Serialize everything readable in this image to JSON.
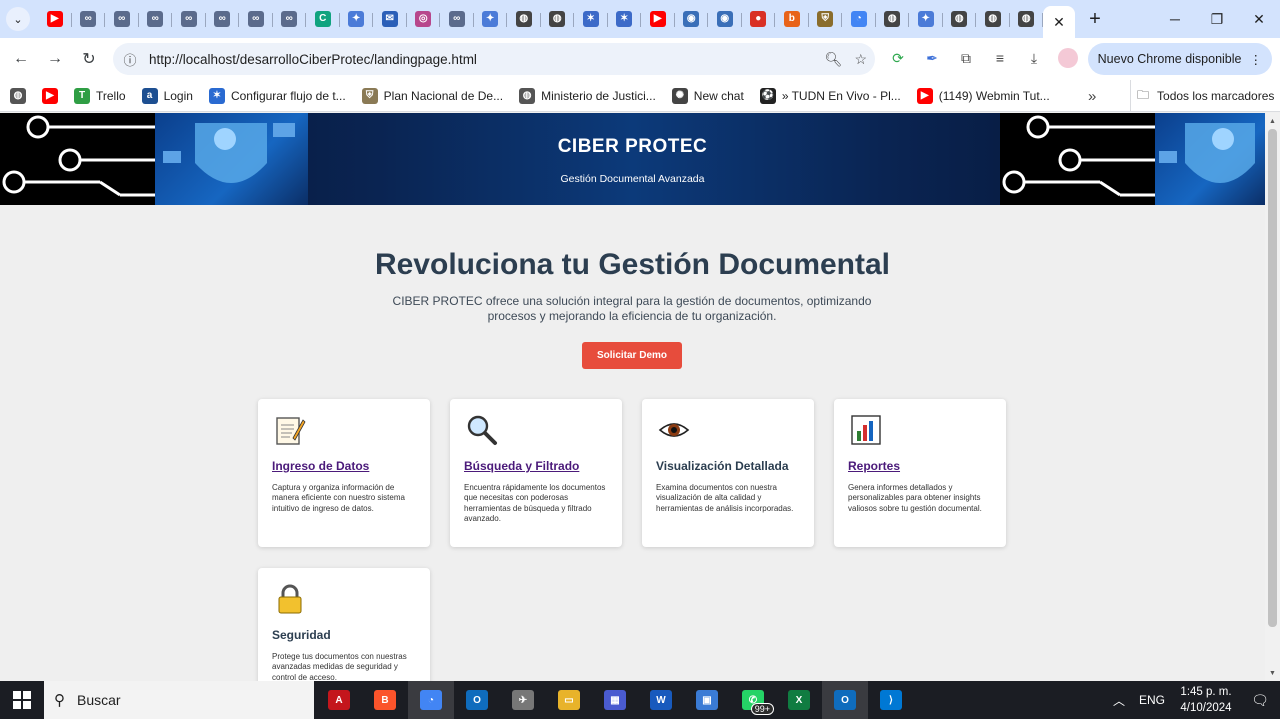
{
  "browser": {
    "tabs": [
      {
        "icon": "youtube-icon",
        "color": "#ff0000",
        "glyph": "▶"
      },
      {
        "icon": "app-icon",
        "color": "#5b6b8c",
        "glyph": "∞"
      },
      {
        "icon": "app-icon",
        "color": "#5b6b8c",
        "glyph": "∞"
      },
      {
        "icon": "app-icon",
        "color": "#5b6b8c",
        "glyph": "∞"
      },
      {
        "icon": "app-icon",
        "color": "#5b6b8c",
        "glyph": "∞"
      },
      {
        "icon": "app-icon",
        "color": "#5b6b8c",
        "glyph": "∞"
      },
      {
        "icon": "app-icon",
        "color": "#5b6b8c",
        "glyph": "∞"
      },
      {
        "icon": "app-icon",
        "color": "#5b6b8c",
        "glyph": "∞"
      },
      {
        "icon": "chatgpt-icon",
        "color": "#10a37f",
        "glyph": "C"
      },
      {
        "icon": "gemini-icon",
        "color": "#4b7bd8",
        "glyph": "✦"
      },
      {
        "icon": "mail-icon",
        "color": "#2b5fb8",
        "glyph": "✉"
      },
      {
        "icon": "app-icon",
        "color": "#b7478c",
        "glyph": "◎"
      },
      {
        "icon": "app-icon",
        "color": "#5b6b8c",
        "glyph": "∞"
      },
      {
        "icon": "gemini-icon",
        "color": "#4b7bd8",
        "glyph": "✦"
      },
      {
        "icon": "globe-icon",
        "color": "#444444",
        "glyph": "◍"
      },
      {
        "icon": "globe-icon",
        "color": "#444444",
        "glyph": "◍"
      },
      {
        "icon": "jira-icon",
        "color": "#3c6ac8",
        "glyph": "✶"
      },
      {
        "icon": "jira-icon",
        "color": "#3c6ac8",
        "glyph": "✶"
      },
      {
        "icon": "youtube-icon",
        "color": "#ff0000",
        "glyph": "▶"
      },
      {
        "icon": "seal-icon",
        "color": "#3a6fb8",
        "glyph": "◉"
      },
      {
        "icon": "seal-icon",
        "color": "#3a6fb8",
        "glyph": "◉"
      },
      {
        "icon": "record-icon",
        "color": "#d93025",
        "glyph": "●"
      },
      {
        "icon": "app-icon",
        "color": "#e8631a",
        "glyph": "b"
      },
      {
        "icon": "shield-icon",
        "color": "#8a6d2c",
        "glyph": "⛨"
      },
      {
        "icon": "chrome-icon",
        "color": "#4285f4",
        "glyph": "◔"
      },
      {
        "icon": "globe-icon",
        "color": "#444444",
        "glyph": "◍"
      },
      {
        "icon": "gemini-icon",
        "color": "#4b7bd8",
        "glyph": "✦"
      },
      {
        "icon": "globe-icon",
        "color": "#444444",
        "glyph": "◍"
      },
      {
        "icon": "globe-icon",
        "color": "#444444",
        "glyph": "◍"
      },
      {
        "icon": "globe-icon",
        "color": "#444444",
        "glyph": "◍"
      }
    ],
    "url": "http://localhost/desarrolloCiberProtec/landingpage.html",
    "update_label": "Nuevo Chrome disponible",
    "bookmarks": [
      {
        "label": "",
        "icon": "globe-icon",
        "color": "#555555",
        "glyph": "◍"
      },
      {
        "label": "",
        "icon": "youtube-icon",
        "color": "#ff0000",
        "glyph": "▶"
      },
      {
        "label": "Trello",
        "icon": "trello-icon",
        "color": "#2f9e44",
        "glyph": "T"
      },
      {
        "label": "Login",
        "icon": "login-icon",
        "color": "#1d4f91",
        "glyph": "a"
      },
      {
        "label": "Configurar flujo de t...",
        "icon": "jira-icon",
        "color": "#2a6ad1",
        "glyph": "✶"
      },
      {
        "label": "Plan Nacional de De...",
        "icon": "seal-icon",
        "color": "#8a7a55",
        "glyph": "⛨"
      },
      {
        "label": "Ministerio de Justici...",
        "icon": "globe-icon",
        "color": "#555555",
        "glyph": "◍"
      },
      {
        "label": "New chat",
        "icon": "chatgpt-icon",
        "color": "#444444",
        "glyph": "✺"
      },
      {
        "label": "» TUDN En Vivo - Pl...",
        "icon": "soccer-icon",
        "color": "#222222",
        "glyph": "⚽"
      },
      {
        "label": "(1149) Webmin Tut...",
        "icon": "youtube-icon",
        "color": "#ff0000",
        "glyph": "▶"
      }
    ],
    "all_bookmarks_label": "Todos los marcadores"
  },
  "hero": {
    "title": "CIBER PROTEC",
    "subtitle": "Gestión Documental Avanzada"
  },
  "main": {
    "headline": "Revoluciona tu Gestión Documental",
    "lead": "CIBER PROTEC ofrece una solución integral para la gestión de documentos, optimizando procesos y mejorando la eficiencia de tu organización.",
    "cta_label": "Solicitar Demo"
  },
  "features": [
    {
      "icon": "memo-icon",
      "title": "Ingreso de Datos",
      "link": true,
      "desc": "Captura y organiza información de manera eficiente con nuestro sistema intuitivo de ingreso de datos."
    },
    {
      "icon": "magnifier-icon",
      "title": "Búsqueda y Filtrado",
      "link": true,
      "desc": "Encuentra rápidamente los documentos que necesitas con poderosas herramientas de búsqueda y filtrado avanzado."
    },
    {
      "icon": "eye-icon",
      "title": "Visualización Detallada",
      "link": false,
      "desc": "Examina documentos con nuestra visualización de alta calidad y herramientas de análisis incorporadas."
    },
    {
      "icon": "bar-chart-icon",
      "title": "Reportes",
      "link": true,
      "desc": "Genera informes detallados y personalizables para obtener insights valiosos sobre tu gestión documental."
    },
    {
      "icon": "lock-icon",
      "title": "Seguridad",
      "link": false,
      "desc": "Protege tus documentos con nuestras avanzadas medidas de seguridad y control de acceso."
    }
  ],
  "taskbar": {
    "search_label": "Buscar",
    "apps": [
      {
        "icon": "pdf-icon",
        "color": "#c4161c",
        "glyph": "A"
      },
      {
        "icon": "brave-icon",
        "color": "#fb542b",
        "glyph": "B"
      },
      {
        "icon": "chrome-icon",
        "color": "#4285f4",
        "glyph": "◔",
        "active": true
      },
      {
        "icon": "outlook-icon",
        "color": "#0f6cbd",
        "glyph": "O"
      },
      {
        "icon": "app-icon",
        "color": "#777777",
        "glyph": "✈"
      },
      {
        "icon": "folder-icon",
        "color": "#e8b32a",
        "glyph": "▭"
      },
      {
        "icon": "calculator-icon",
        "color": "#4a5bd0",
        "glyph": "▦"
      },
      {
        "icon": "word-icon",
        "color": "#185abd",
        "glyph": "W"
      },
      {
        "icon": "app-icon",
        "color": "#3a7bd5",
        "glyph": "▣"
      },
      {
        "icon": "whatsapp-icon",
        "color": "#25d366",
        "glyph": "✆",
        "badge": "99+"
      },
      {
        "icon": "excel-icon",
        "color": "#107c41",
        "glyph": "X"
      },
      {
        "icon": "outlook-icon",
        "color": "#0f6cbd",
        "glyph": "O",
        "active": true
      },
      {
        "icon": "vscode-icon",
        "color": "#0078d4",
        "glyph": "⟩"
      }
    ],
    "lang": "ENG",
    "time": "1:45 p. m.",
    "date": "4/10/2024"
  }
}
